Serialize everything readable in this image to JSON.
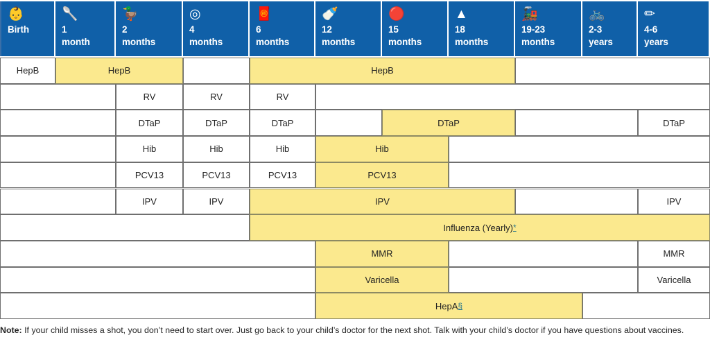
{
  "table": {
    "age_columns": [
      {
        "icon": "baby-stroller-icon",
        "glyph": "👶",
        "line1": "Birth",
        "line2": ""
      },
      {
        "icon": "rattle-icon",
        "glyph": "🥄",
        "line1": "1",
        "line2": "month"
      },
      {
        "icon": "rubber-duck-icon",
        "glyph": "🦆",
        "line1": "2",
        "line2": "months"
      },
      {
        "icon": "baby-rings-toy-icon",
        "glyph": "◎",
        "line1": "4",
        "line2": "months"
      },
      {
        "icon": "bib-icon",
        "glyph": "🧧",
        "line1": "6",
        "line2": "months"
      },
      {
        "icon": "baby-bottle-icon",
        "glyph": "🍼",
        "line1": "12",
        "line2": "months"
      },
      {
        "icon": "beach-ball-icon",
        "glyph": "🔴",
        "line1": "15",
        "line2": "months"
      },
      {
        "icon": "stacking-rings-icon",
        "glyph": "▲",
        "line1": "18",
        "line2": "months"
      },
      {
        "icon": "toy-train-icon",
        "glyph": "🚂",
        "line1": "19-23",
        "line2": "months"
      },
      {
        "icon": "tricycle-icon",
        "glyph": "🚲",
        "line1": "2-3",
        "line2": "years"
      },
      {
        "icon": "crayon-drawing-icon",
        "glyph": "✏",
        "line1": "4-6",
        "line2": "years"
      }
    ],
    "rows": [
      {
        "vaccine": "HepB",
        "cells": [
          {
            "label": "HepB",
            "start": 0,
            "span": 1,
            "highlight": false
          },
          {
            "label": "HepB",
            "start": 1,
            "span": 2,
            "highlight": true
          },
          {
            "label": "",
            "start": 3,
            "span": 1,
            "highlight": false
          },
          {
            "label": "HepB",
            "start": 4,
            "span": 4,
            "highlight": true
          },
          {
            "label": "",
            "start": 8,
            "span": 3,
            "highlight": false
          }
        ]
      },
      {
        "vaccine": "RV",
        "cells": [
          {
            "label": "",
            "start": 0,
            "span": 2,
            "highlight": false
          },
          {
            "label": "RV",
            "start": 2,
            "span": 1,
            "highlight": false
          },
          {
            "label": "RV",
            "start": 3,
            "span": 1,
            "highlight": false
          },
          {
            "label": "RV",
            "start": 4,
            "span": 1,
            "highlight": false
          },
          {
            "label": "",
            "start": 5,
            "span": 6,
            "highlight": false
          }
        ]
      },
      {
        "vaccine": "DTaP",
        "cells": [
          {
            "label": "",
            "start": 0,
            "span": 2,
            "highlight": false
          },
          {
            "label": "DTaP",
            "start": 2,
            "span": 1,
            "highlight": false
          },
          {
            "label": "DTaP",
            "start": 3,
            "span": 1,
            "highlight": false
          },
          {
            "label": "DTaP",
            "start": 4,
            "span": 1,
            "highlight": false
          },
          {
            "label": "",
            "start": 5,
            "span": 1,
            "highlight": false
          },
          {
            "label": "DTaP",
            "start": 6,
            "span": 2,
            "highlight": true
          },
          {
            "label": "",
            "start": 8,
            "span": 2,
            "highlight": false
          },
          {
            "label": "DTaP",
            "start": 10,
            "span": 1,
            "highlight": false
          }
        ]
      },
      {
        "vaccine": "Hib",
        "cells": [
          {
            "label": "",
            "start": 0,
            "span": 2,
            "highlight": false
          },
          {
            "label": "Hib",
            "start": 2,
            "span": 1,
            "highlight": false
          },
          {
            "label": "Hib",
            "start": 3,
            "span": 1,
            "highlight": false
          },
          {
            "label": "Hib",
            "start": 4,
            "span": 1,
            "highlight": false
          },
          {
            "label": "Hib",
            "start": 5,
            "span": 2,
            "highlight": true
          },
          {
            "label": "",
            "start": 7,
            "span": 4,
            "highlight": false
          }
        ]
      },
      {
        "vaccine": "PCV13",
        "cells": [
          {
            "label": "",
            "start": 0,
            "span": 2,
            "highlight": false
          },
          {
            "label": "PCV13",
            "start": 2,
            "span": 1,
            "highlight": false
          },
          {
            "label": "PCV13",
            "start": 3,
            "span": 1,
            "highlight": false
          },
          {
            "label": "PCV13",
            "start": 4,
            "span": 1,
            "highlight": false
          },
          {
            "label": "PCV13",
            "start": 5,
            "span": 2,
            "highlight": true
          },
          {
            "label": "",
            "start": 7,
            "span": 4,
            "highlight": false
          }
        ]
      },
      {
        "vaccine": "IPV",
        "cells": [
          {
            "label": "",
            "start": 0,
            "span": 2,
            "highlight": false
          },
          {
            "label": "IPV",
            "start": 2,
            "span": 1,
            "highlight": false
          },
          {
            "label": "IPV",
            "start": 3,
            "span": 1,
            "highlight": false
          },
          {
            "label": "IPV",
            "start": 4,
            "span": 4,
            "highlight": true
          },
          {
            "label": "",
            "start": 8,
            "span": 2,
            "highlight": false
          },
          {
            "label": "IPV",
            "start": 10,
            "span": 1,
            "highlight": false
          }
        ]
      },
      {
        "vaccine": "Influenza",
        "cells": [
          {
            "label": "",
            "start": 0,
            "span": 4,
            "highlight": false
          },
          {
            "label": "Influenza (Yearly)",
            "footnote": "*",
            "start": 4,
            "span": 7,
            "highlight": true
          }
        ]
      },
      {
        "vaccine": "MMR",
        "cells": [
          {
            "label": "",
            "start": 0,
            "span": 5,
            "highlight": false
          },
          {
            "label": "MMR",
            "start": 5,
            "span": 2,
            "highlight": true
          },
          {
            "label": "",
            "start": 7,
            "span": 3,
            "highlight": false
          },
          {
            "label": "MMR",
            "start": 10,
            "span": 1,
            "highlight": false
          }
        ]
      },
      {
        "vaccine": "Varicella",
        "cells": [
          {
            "label": "",
            "start": 0,
            "span": 5,
            "highlight": false
          },
          {
            "label": "Varicella",
            "start": 5,
            "span": 2,
            "highlight": true
          },
          {
            "label": "",
            "start": 7,
            "span": 3,
            "highlight": false
          },
          {
            "label": "Varicella",
            "start": 10,
            "span": 1,
            "highlight": false
          }
        ]
      },
      {
        "vaccine": "HepA",
        "cells": [
          {
            "label": "",
            "start": 0,
            "span": 5,
            "highlight": false
          },
          {
            "label": "HepA",
            "footnote": "§",
            "start": 5,
            "span": 4,
            "highlight": true
          },
          {
            "label": "",
            "start": 9,
            "span": 2,
            "highlight": false
          }
        ]
      }
    ],
    "column_edges": [
      0,
      80,
      167,
      264,
      360,
      455,
      551,
      647,
      743,
      840,
      920,
      1024
    ],
    "row_height": 37.7
  },
  "footnote": {
    "label": "Note:",
    "text": " If your child misses a shot, you don’t need to start over. Just go back to your child’s doctor for the next shot. Talk with your child’s doctor if you have questions about vaccines."
  },
  "colors": {
    "header_blue": "#1060A8",
    "highlight_yellow": "#FBE98E",
    "grid_line": "#6f6f6f",
    "link_teal": "#2d7a8c"
  }
}
